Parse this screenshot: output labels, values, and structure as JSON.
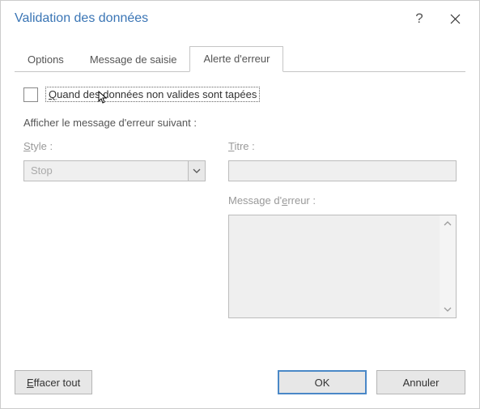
{
  "titlebar": {
    "title": "Validation des données"
  },
  "tabs": {
    "options": "Options",
    "input_message": "Message de saisie",
    "error_alert": "Alerte d'erreur"
  },
  "checkbox": {
    "label_before": "",
    "label_q": "Q",
    "label_after": "uand des données non valides sont tapées"
  },
  "section": {
    "show_error_label": "Afficher le message d'erreur suivant :"
  },
  "style": {
    "label_before": "",
    "label_s": "S",
    "label_after": "tyle :",
    "value": "Stop"
  },
  "title_field": {
    "label_before": "",
    "label_t": "T",
    "label_after": "itre :",
    "value": ""
  },
  "message_field": {
    "label_before": "Message d'",
    "label_e": "e",
    "label_after": "rreur :",
    "value": ""
  },
  "footer": {
    "clear_e": "E",
    "clear_rest": "ffacer tout",
    "ok": "OK",
    "cancel": "Annuler"
  }
}
